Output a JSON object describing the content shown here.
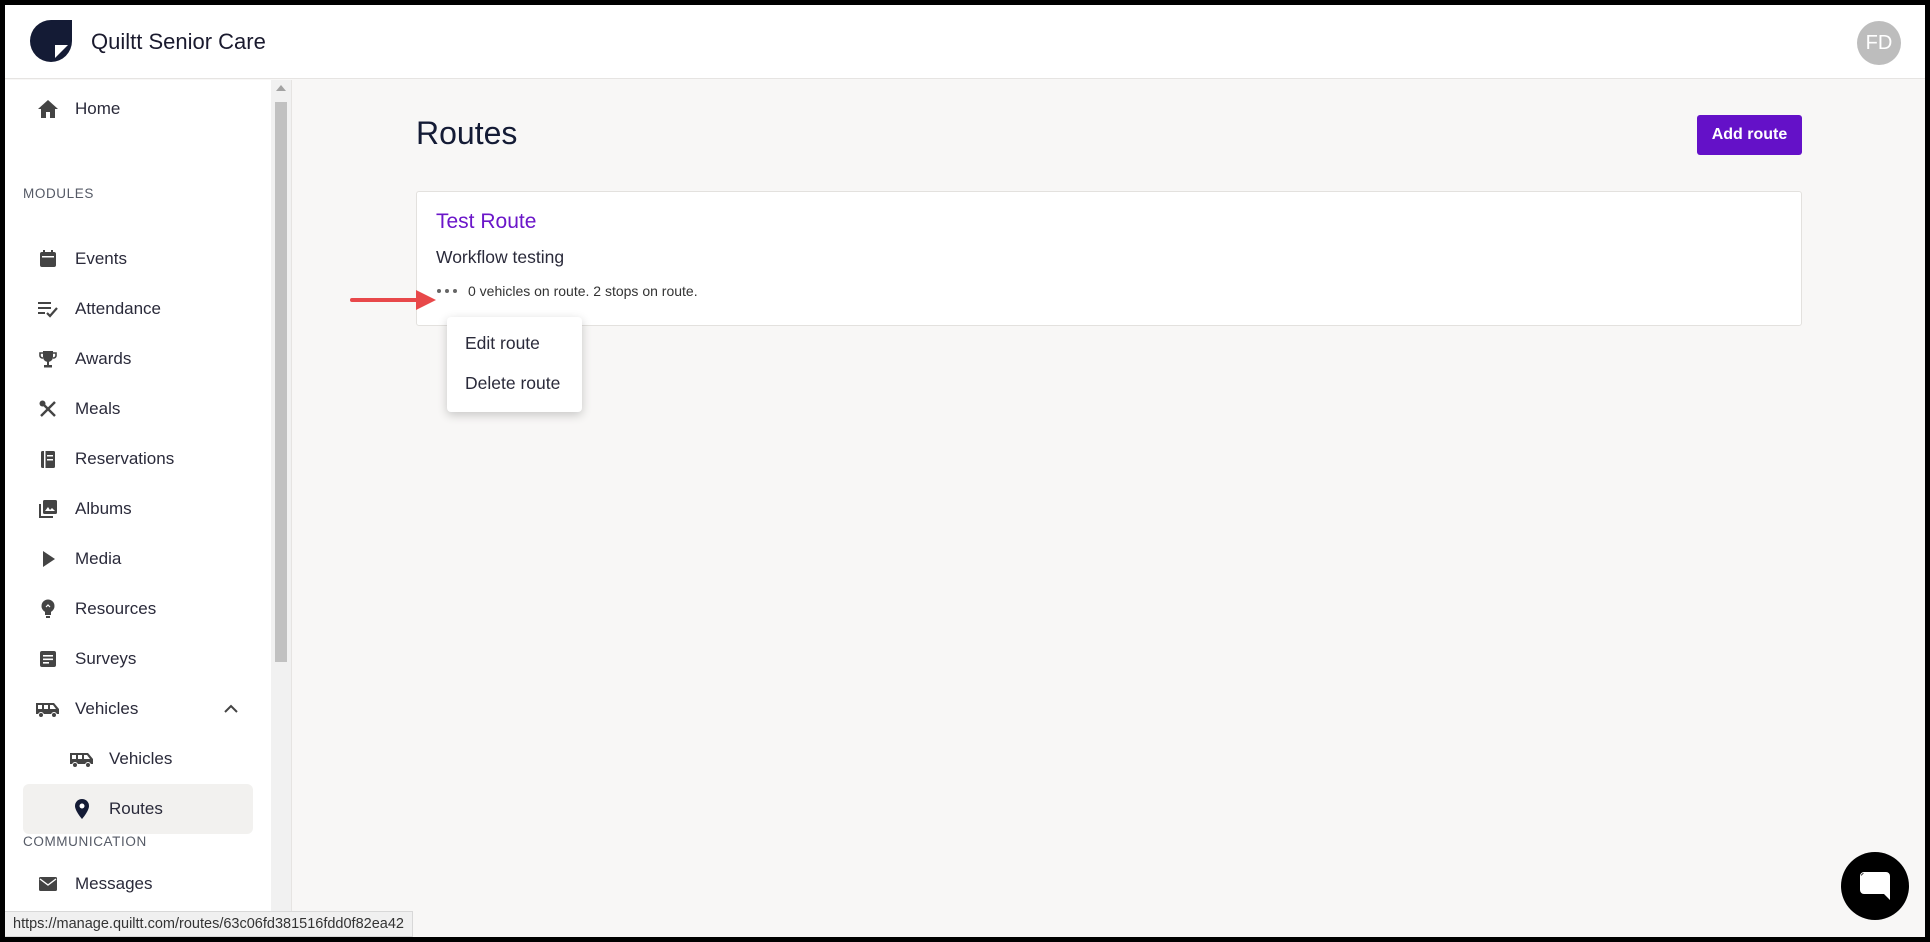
{
  "app": {
    "title": "Quiltt Senior Care",
    "avatar_initials": "FD"
  },
  "sidebar": {
    "home": "Home",
    "modules_label": "MODULES",
    "items": [
      "Events",
      "Attendance",
      "Awards",
      "Meals",
      "Reservations",
      "Albums",
      "Media",
      "Resources",
      "Surveys",
      "Vehicles"
    ],
    "vehicles_sub": [
      "Vehicles",
      "Routes"
    ],
    "communication_label": "COMMUNICATION",
    "messages": "Messages"
  },
  "main": {
    "title": "Routes",
    "add_button": "Add route",
    "route": {
      "name": "Test Route",
      "description": "Workflow testing",
      "meta": "0 vehicles on route. 2 stops on route."
    },
    "menu": [
      "Edit route",
      "Delete route"
    ]
  },
  "status_url": "https://manage.quiltt.com/routes/63c06fd381516fdd0f82ea42",
  "colors": {
    "accent": "#6411c8",
    "link": "#6b16c9",
    "arrow": "#e8484a"
  }
}
